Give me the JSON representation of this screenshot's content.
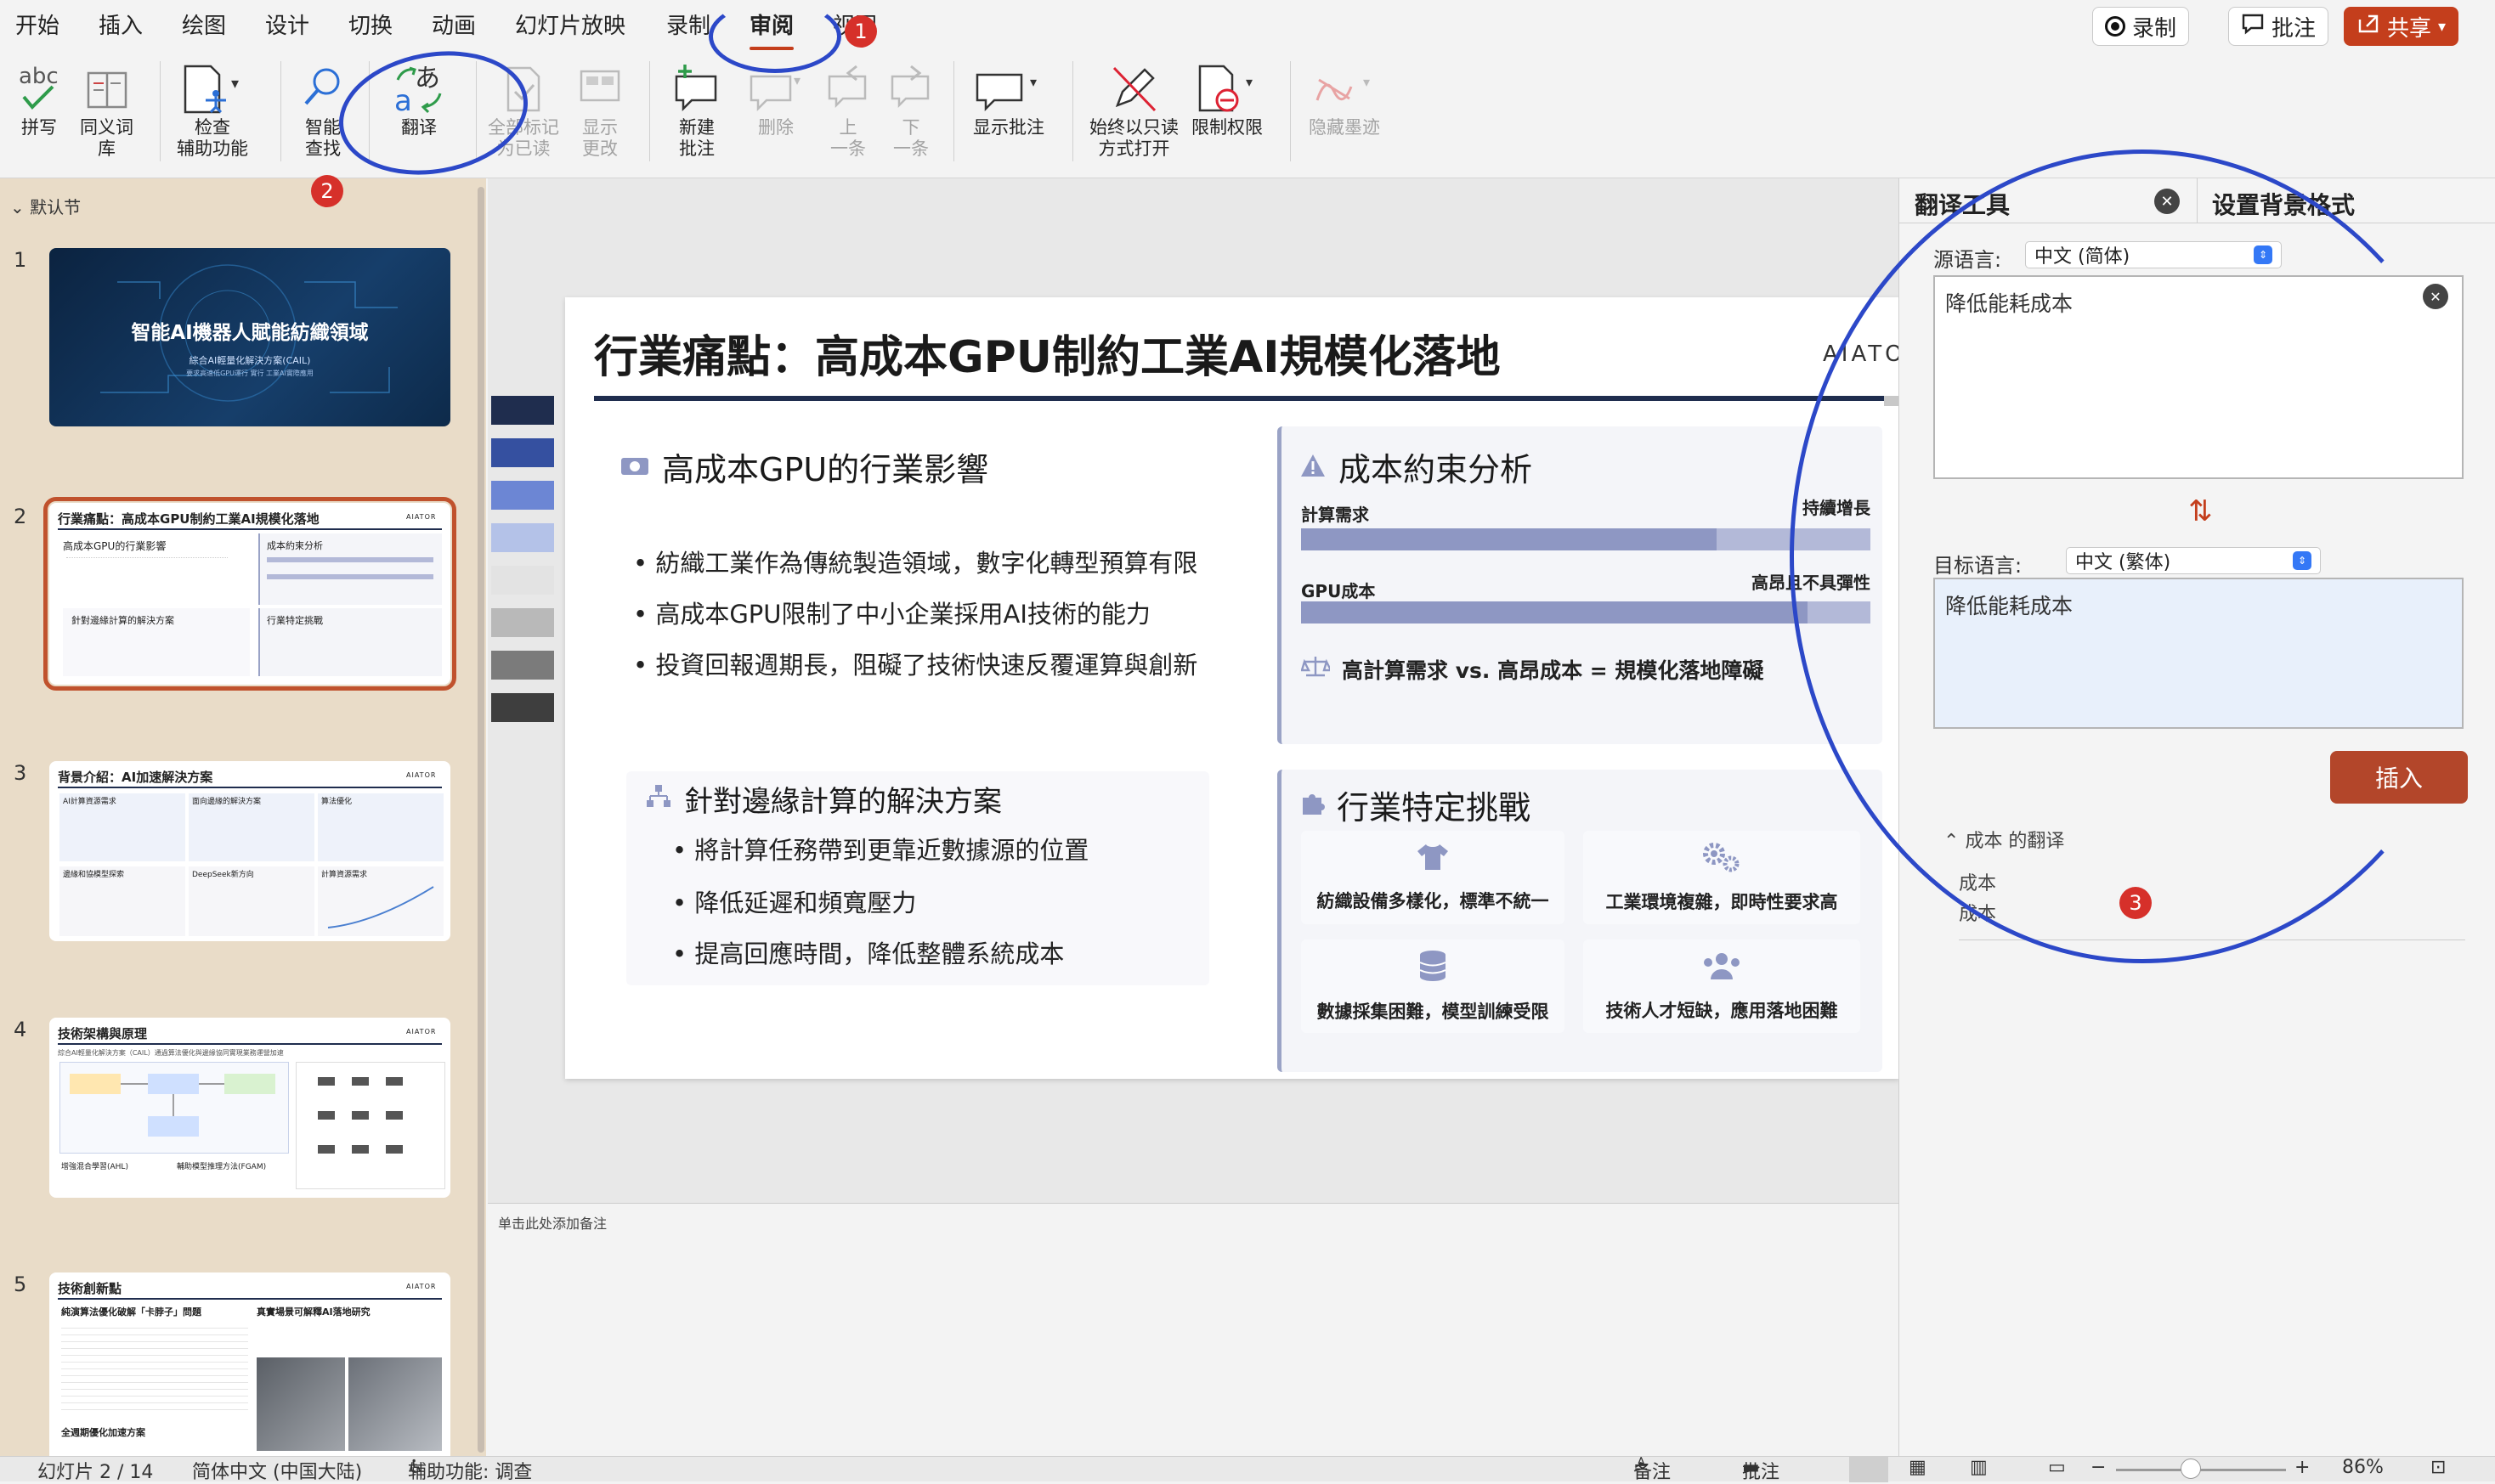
{
  "menu_tabs": [
    "开始",
    "插入",
    "绘图",
    "设计",
    "切换",
    "动画",
    "幻灯片放映",
    "录制",
    "审阅",
    "视图"
  ],
  "active_tab": "审阅",
  "top_buttons": {
    "record": "录制",
    "comment": "批注",
    "share": "共享"
  },
  "ribbon": {
    "spelling": "拼写",
    "thesaurus": "同义词\n库",
    "accessibility": "检查\n辅助功能",
    "smart_lookup": "智能\n查找",
    "translate": "翻译",
    "mark_all_read": "全部标记\n为已读",
    "show_changes": "显示\n更改",
    "new_comment": "新建\n批注",
    "delete": "删除",
    "previous": "上\n一条",
    "next": "下\n一条",
    "show_comments": "显示批注",
    "always_open_readonly": "始终以只读\n方式打开",
    "restrict_access": "限制权限",
    "hide_ink": "隐藏墨迹"
  },
  "left_panel": {
    "section": "默认节",
    "slide_numbers": [
      "1",
      "2",
      "3",
      "4",
      "5"
    ],
    "thumbnails": [
      {
        "title": "智能AI機器人賦能紡織領域",
        "subtitle": "綜合AI輕量化解決方案(CAIL)",
        "footer": "要求高速低GPU運行 實行 工業AI實際應用"
      },
      {
        "title": "行業痛點：高成本GPU制約工業AI規模化落地",
        "logo": "AIATOR",
        "h1": "高成本GPU的行業影響",
        "h2": "成本約束分析",
        "h3": "針對邊緣計算的解決方案",
        "h4": "行業特定挑戰"
      },
      {
        "title": "背景介紹：AI加速解決方案",
        "logo": "AIATOR",
        "h1": "AI計算資源需求",
        "h2": "面向邊緣的解決方案",
        "h3": "算法優化",
        "h4": "邊緣和協模型探索",
        "h5": "DeepSeek新方向",
        "h6": "計算資源需求"
      },
      {
        "title": "技術架構與原理",
        "logo": "AIATOR",
        "subtitle": "綜合AI輕量化解決方案（CAIL）通過算法優化與邊緣協同實現業務運營加速",
        "h1": "增強混合學習(AHL)",
        "h2": "輔助模型推理方法(FGAM)"
      },
      {
        "title": "技術創新點",
        "logo": "AIATOR",
        "h1": "純演算法優化破解「卡脖子」問題",
        "h2": "真實場景可解釋AI落地研究",
        "h3": "全週期優化加速方案"
      }
    ]
  },
  "slide": {
    "title": "行業痛點：高成本GPU制約工業AI規模化落地",
    "logo": "AIATOR",
    "impact_title": "高成本GPU的行業影響",
    "impact_bullets": [
      "紡織工業作為傳統製造領域，數字化轉型預算有限",
      "高成本GPU限制了中小企業採用AI技術的能力",
      "投資回報週期長，阻礙了技術快速反覆運算與創新"
    ],
    "cost_title": "成本約束分析",
    "compute_label": "計算需求",
    "compute_value": "持續增長",
    "compute_level": 0.73,
    "gpu_label": "GPU成本",
    "gpu_value": "高昂且不具彈性",
    "gpu_level": 0.89,
    "conclusion": "高計算需求 vs. 高昂成本 = 規模化落地障礙",
    "edge_title": "針對邊緣計算的解決方案",
    "edge_bullets": [
      "將計算任務帶到更靠近數據源的位置",
      "降低延遲和頻寬壓力",
      "提高回應時間，降低整體系統成本"
    ],
    "challenge_title": "行業特定挑戰",
    "challenges": [
      "紡織設備多樣化，標準不統一",
      "工業環境複雜，即時性要求高",
      "數據採集困難，模型訓練受限",
      "技術人才短缺，應用落地困難"
    ]
  },
  "notes_placeholder": "单击此处添加备注",
  "translator": {
    "tab_title": "翻译工具",
    "tab_format": "设置背景格式",
    "source_label": "源语言:",
    "source_lang": "中文 (简体)",
    "source_text": "降低能耗成本",
    "target_label": "目标语言:",
    "target_lang": "中文 (繁体)",
    "target_text": "降低能耗成本",
    "insert": "插入",
    "translation_header": "成本 的翻译",
    "translation_lines": [
      "成本",
      "成本"
    ]
  },
  "status_bar": {
    "slide_info": "幻灯片 2 / 14",
    "language": "简体中文 (中国大陆)",
    "accessibility": "辅助功能: 调查",
    "notes": "备注",
    "comments": "批注",
    "zoom": "86%"
  },
  "annotation_badges": [
    "1",
    "2",
    "3"
  ],
  "colors": {
    "accent": "#c43e1c",
    "annotation_ring": "#2c48c8",
    "badge": "#d6302a",
    "slide_navy": "#1f2d4e",
    "bar_fill": "#8e97c3"
  }
}
